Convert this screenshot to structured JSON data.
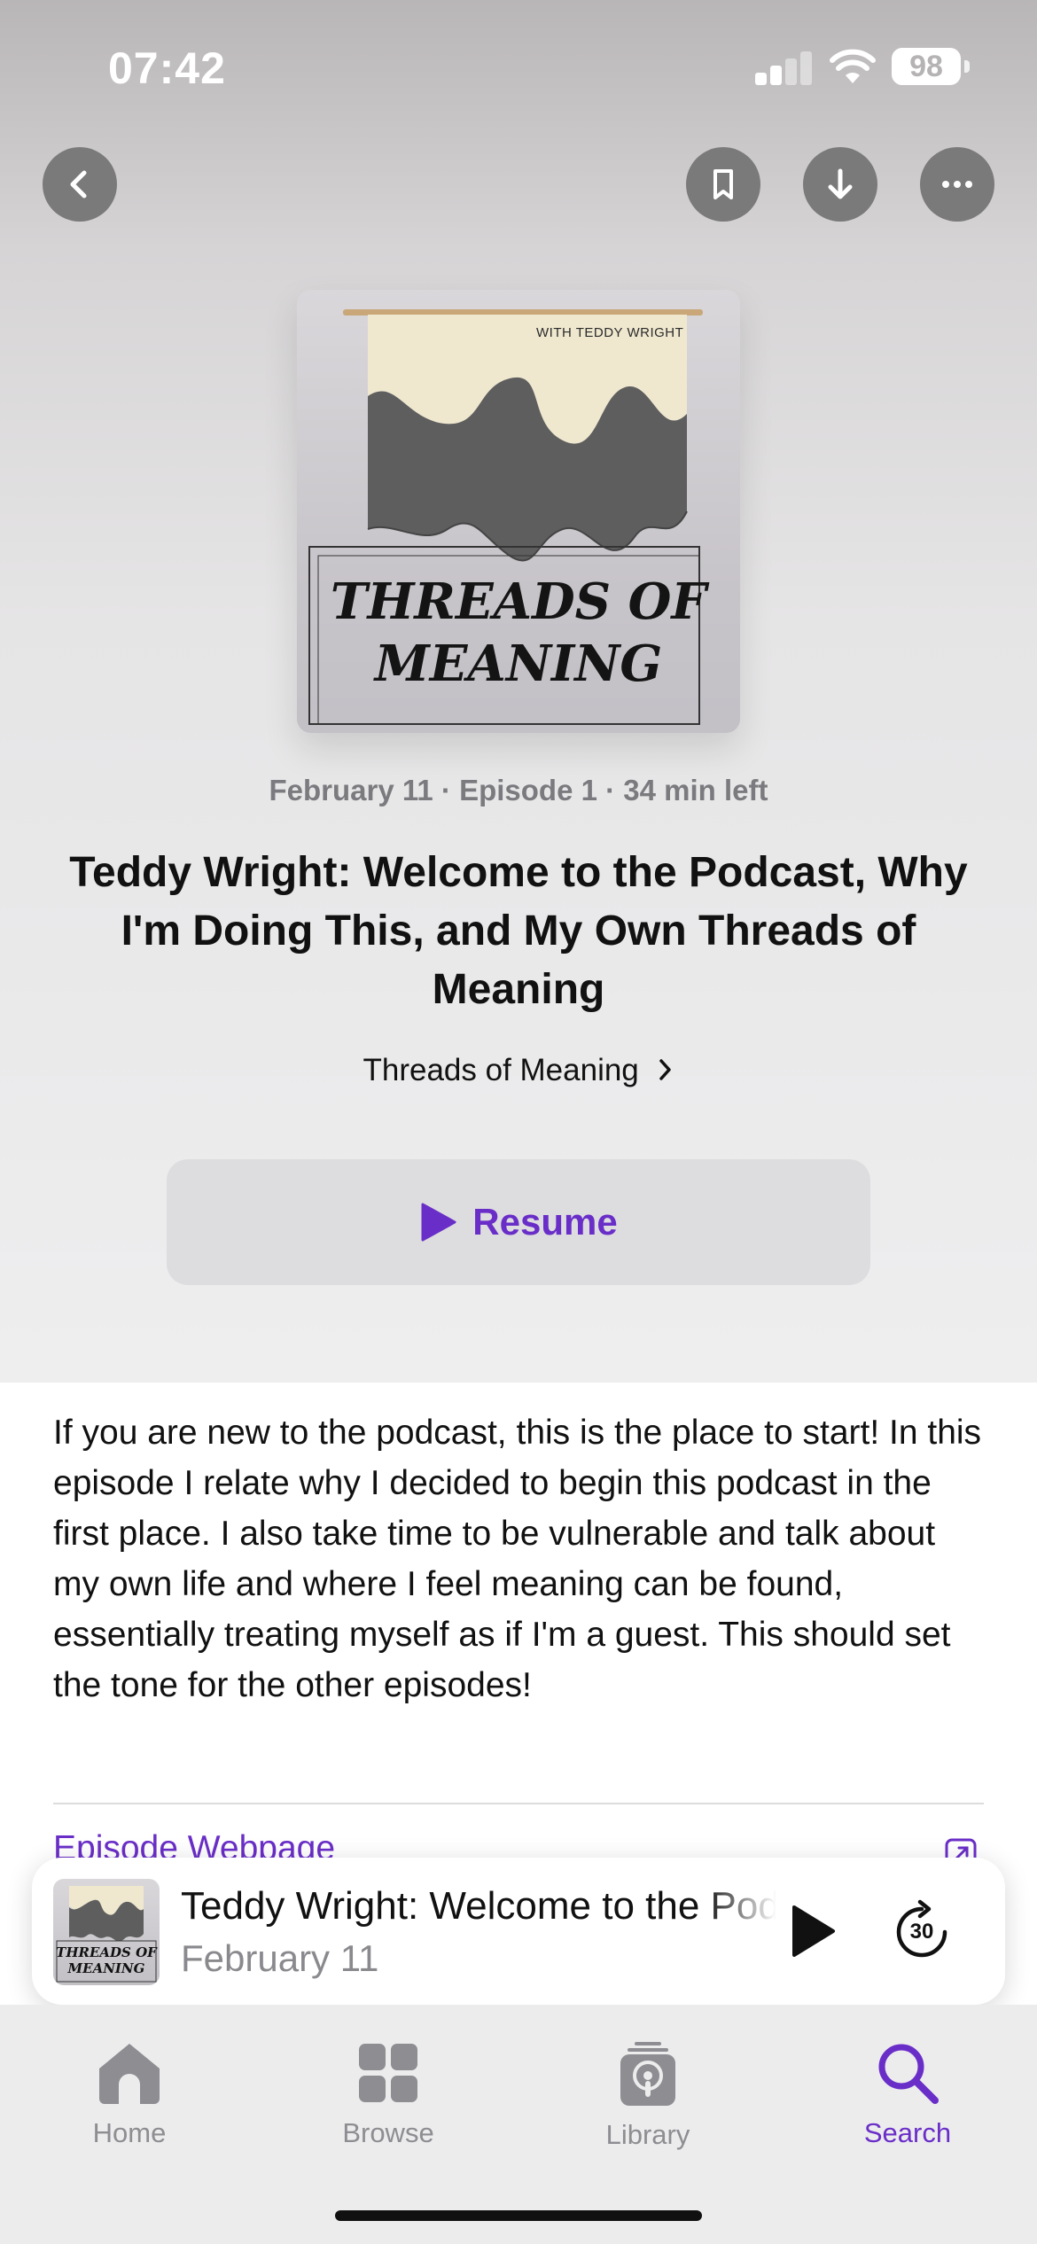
{
  "status_bar": {
    "time": "07:42",
    "battery": "98"
  },
  "top_actions": {
    "back": "chevron-left-icon",
    "bookmark": "bookmark-icon",
    "download": "arrow-down-icon",
    "more": "ellipsis-icon"
  },
  "artwork": {
    "caption": "WITH TEDDY WRIGHT",
    "title_line1": "THREADS OF",
    "title_line2": "MEANING"
  },
  "episode": {
    "meta": "February 11 · Episode 1 · 34 min left",
    "title": "Teddy Wright: Welcome to the Podcast, Why I'm Doing This,  and My Own Threads of Meaning",
    "show_name": "Threads of Meaning",
    "resume_label": "Resume",
    "description": "If you are new to the podcast, this is the place to start! In this episode I relate why I decided to begin this podcast in the first place. I also take time to be vulnerable and talk about my own life and where I feel meaning can be found, essentially treating myself as if I'm a guest. This should set the tone for the other episodes!",
    "webpage_link": "Episode Webpage"
  },
  "mini_player": {
    "title": "Teddy Wright: Welcome to the Podcast, Why I'm Doing This",
    "date": "February 11",
    "skip_seconds": "30",
    "art_line1": "THREADS OF",
    "art_line2": "MEANING"
  },
  "tab_bar": {
    "items": [
      {
        "label": "Home",
        "icon": "house-icon"
      },
      {
        "label": "Browse",
        "icon": "grid-icon"
      },
      {
        "label": "Library",
        "icon": "podcast-stack-icon"
      },
      {
        "label": "Search",
        "icon": "magnifying-glass-icon"
      }
    ],
    "active": "Search"
  },
  "colors": {
    "accent": "#6a2ec8",
    "inactive_tab": "#8d8d92",
    "button_gray": "#7b7a7b"
  }
}
